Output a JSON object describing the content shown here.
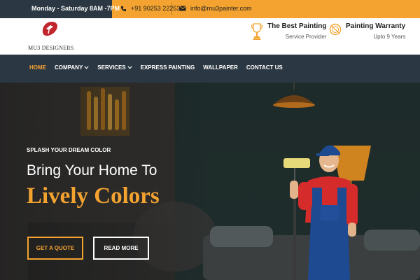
{
  "topbar": {
    "hours": "Monday - Saturday  8AM -7PM",
    "phone": "+91 90253 22253",
    "email": "info@mu3painter.com",
    "phone_icon": "phone-icon",
    "email_icon": "mail-icon"
  },
  "header": {
    "brand": "MU3 DESIGNERS",
    "features": [
      {
        "title": "The Best Painting",
        "subtitle": "Service Provider",
        "icon": "trophy-icon"
      },
      {
        "title": "Painting Warranty",
        "subtitle": "Upto 9 Years",
        "icon": "badge-icon"
      }
    ]
  },
  "nav": {
    "items": [
      {
        "label": "HOME",
        "active": true
      },
      {
        "label": "COMPANY",
        "dropdown": true
      },
      {
        "label": "SERVICES",
        "dropdown": true
      },
      {
        "label": "EXPRESS PAINTING"
      },
      {
        "label": "WALLPAPER"
      },
      {
        "label": "CONTACT US"
      }
    ]
  },
  "hero": {
    "eyebrow": "SPLASH YOUR DREAM COLOR",
    "headline": "Bring Your Home To",
    "headline_accent": "Lively Colors",
    "cta_primary": "GET A QUOTE",
    "cta_secondary": "READ MORE"
  },
  "colors": {
    "accent": "#f4a330",
    "nav_bg": "#2b3742",
    "brand_red": "#c0272d"
  }
}
